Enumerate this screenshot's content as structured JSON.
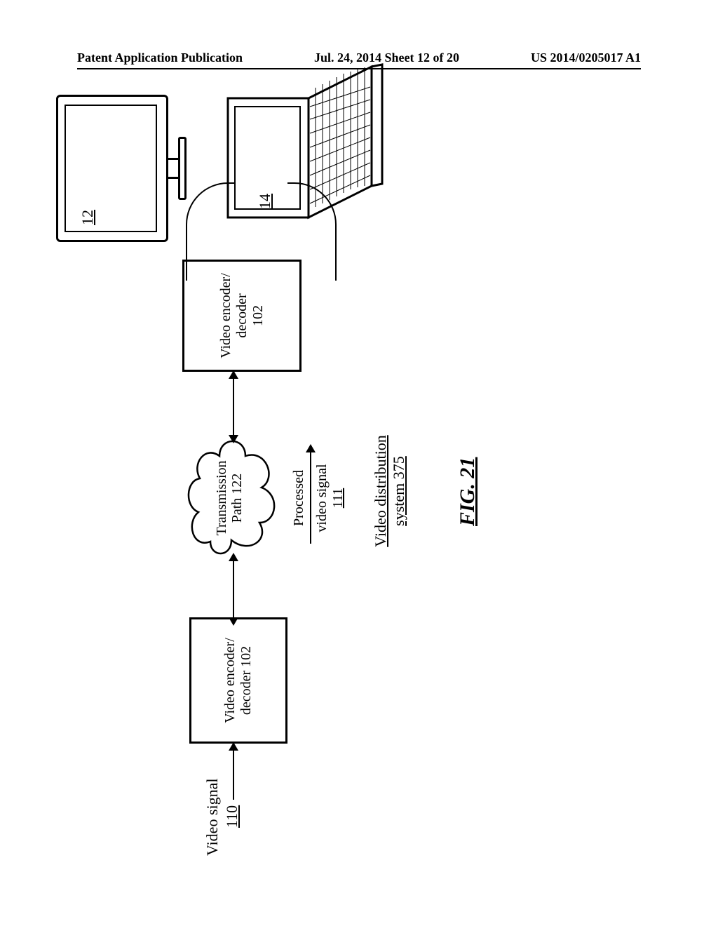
{
  "header": {
    "left": "Patent Application Publication",
    "center": "Jul. 24, 2014  Sheet 12 of 20",
    "right": "US 2014/0205017 A1"
  },
  "diagram": {
    "video_signal_label": "Video signal",
    "video_signal_num": "110",
    "encoder1_line1": "Video encoder/",
    "encoder1_line2": "decoder 102",
    "cloud_line1": "Transmission",
    "cloud_line2": "Path 122",
    "processed_line1": "Processed",
    "processed_line2": "video signal",
    "processed_line3": "111",
    "vds_line1": "Video distribution",
    "vds_line2": "system 375",
    "encoder2_line1": "Video encoder/",
    "encoder2_line2": "decoder",
    "encoder2_line3": "102",
    "monitor_ref": "12",
    "laptop_ref": "14",
    "figure": "FIG. 21"
  }
}
